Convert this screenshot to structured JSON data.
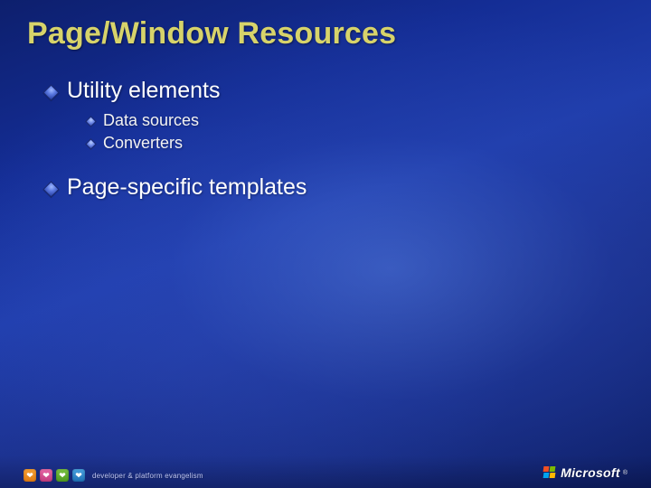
{
  "slide": {
    "title": "Page/Window Resources",
    "bullets": [
      {
        "text": "Utility elements",
        "children": [
          {
            "text": "Data sources"
          },
          {
            "text": "Converters"
          }
        ]
      },
      {
        "text": "Page-specific templates",
        "children": []
      }
    ]
  },
  "footer": {
    "evangelism_text": "developer & platform evangelism",
    "brand": "Microsoft",
    "registered": "®"
  },
  "colors": {
    "title": "#d7d36a",
    "body": "#ffffff",
    "bg_start": "#0d1f6d",
    "bg_end": "#1a2f8a"
  }
}
